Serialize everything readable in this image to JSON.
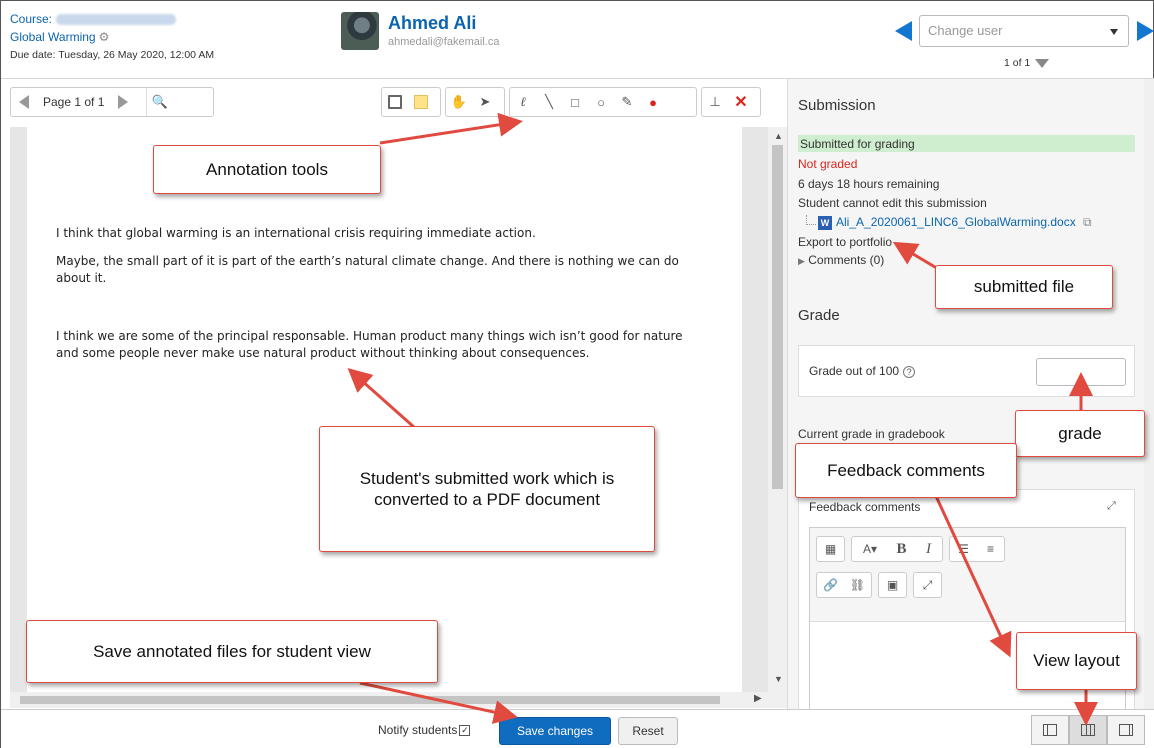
{
  "header": {
    "course_label": "Course:",
    "assignment_name": "Global Warming",
    "due_date": "Due date: Tuesday, 26 May 2020, 12:00 AM",
    "user_name": "Ahmed Ali",
    "user_email": "ahmedali@fakemail.ca",
    "change_user_placeholder": "Change user",
    "user_count": "1 of 1"
  },
  "toolbar": {
    "page_label": "Page 1 of 1"
  },
  "document": {
    "paragraphs": [
      "I think that global warming is an international crisis requiring immediate action.",
      "Maybe, the small part of it is part of the earth’s natural climate change. And there is nothing we can do about it.",
      "I think we are some of the principal responsable.  Human product many things wich isn’t good for nature and some people never make use natural product without thinking about consequences."
    ]
  },
  "panel": {
    "submission_heading": "Submission",
    "status_submitted": "Submitted for grading",
    "status_graded": "Not graded",
    "time_remaining": "6 days 18 hours remaining",
    "edit_status": "Student cannot edit this submission",
    "file_name": "Ali_A_2020061_LINC6_GlobalWarming.docx",
    "export_link": "Export to portfolio",
    "comments_link": "Comments (0)",
    "grade_heading": "Grade",
    "grade_label": "Grade out of 100",
    "current_grade_label": "Current grade in gradebook",
    "feedback_label": "Feedback comments"
  },
  "footer": {
    "notify_label": "Notify students",
    "save_label": "Save changes",
    "reset_label": "Reset"
  },
  "callouts": {
    "annotation_tools": "Annotation tools",
    "submitted_work": "Student's submitted work which is converted to a PDF document",
    "save_annotated": "Save annotated files for student view",
    "submitted_file": "submitted file",
    "grade": "grade",
    "feedback_comments": "Feedback comments",
    "view_layout": "View layout"
  },
  "colors": {
    "link": "#0a64b0",
    "primary_button": "#0f6cbf",
    "callout_border": "#e04a3f",
    "submitted_bg": "#cfeecf",
    "not_graded": "#d9261c"
  }
}
